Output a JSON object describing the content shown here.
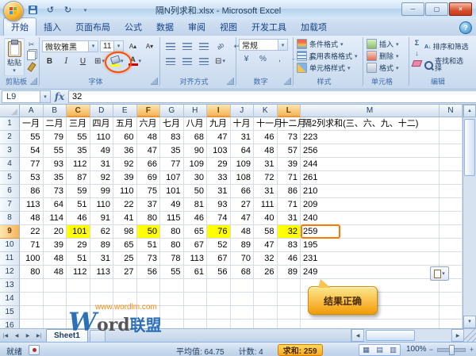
{
  "window": {
    "title": "隔N列求和.xlsx - Microsoft Excel"
  },
  "ribbon": {
    "tabs": [
      "开始",
      "插入",
      "页面布局",
      "公式",
      "数据",
      "审阅",
      "视图",
      "开发工具",
      "加载项"
    ],
    "active_tab": "开始",
    "clipboard": {
      "label": "剪贴板",
      "paste": "粘贴"
    },
    "font": {
      "label": "字体",
      "name": "微软雅黑",
      "size": "11",
      "bold": "B",
      "italic": "I",
      "underline": "U"
    },
    "alignment": {
      "label": "对齐方式"
    },
    "number": {
      "label": "数字",
      "format": "常规"
    },
    "styles": {
      "label": "样式",
      "conditional": "条件格式",
      "format_as_table": "套用表格格式",
      "cell_styles": "单元格样式"
    },
    "cells": {
      "label": "单元格",
      "insert": "插入",
      "delete": "删除",
      "format": "格式"
    },
    "editing": {
      "label": "编辑",
      "sort_filter": "排序和筛选",
      "find_select": "查找和选择"
    }
  },
  "formula_bar": {
    "name_box": "L9",
    "fx": "fx",
    "value": "32"
  },
  "sheet": {
    "columns": [
      "A",
      "B",
      "C",
      "D",
      "E",
      "F",
      "G",
      "H",
      "I",
      "J",
      "K",
      "L",
      "M",
      "N"
    ],
    "selected_columns": [
      "C",
      "F",
      "I",
      "L"
    ],
    "selected_row": 9,
    "month_headers": [
      "一月",
      "二月",
      "三月",
      "四月",
      "五月",
      "六月",
      "七月",
      "八月",
      "九月",
      "十月",
      "十一月",
      "十二月"
    ],
    "sum_header": "隔2列求和(三、六、九、十二)",
    "rows": [
      [
        55,
        79,
        55,
        110,
        60,
        48,
        83,
        68,
        47,
        31,
        46,
        73,
        223
      ],
      [
        54,
        55,
        35,
        49,
        36,
        47,
        35,
        90,
        103,
        64,
        48,
        57,
        256
      ],
      [
        77,
        93,
        112,
        31,
        92,
        66,
        77,
        109,
        29,
        109,
        31,
        39,
        244
      ],
      [
        53,
        35,
        87,
        92,
        39,
        69,
        107,
        30,
        33,
        108,
        72,
        71,
        261
      ],
      [
        86,
        73,
        59,
        99,
        110,
        75,
        101,
        50,
        31,
        66,
        31,
        86,
        210
      ],
      [
        113,
        64,
        51,
        110,
        22,
        37,
        49,
        81,
        93,
        27,
        111,
        71,
        209
      ],
      [
        48,
        114,
        46,
        91,
        41,
        80,
        115,
        46,
        74,
        47,
        40,
        31,
        240
      ],
      [
        22,
        20,
        101,
        62,
        98,
        50,
        80,
        65,
        76,
        48,
        58,
        32,
        259
      ],
      [
        71,
        39,
        29,
        89,
        65,
        51,
        80,
        67,
        52,
        89,
        47,
        83,
        195
      ],
      [
        100,
        48,
        51,
        31,
        25,
        73,
        78,
        113,
        67,
        70,
        32,
        46,
        231
      ],
      [
        80,
        48,
        112,
        113,
        27,
        56,
        55,
        61,
        56,
        68,
        26,
        89,
        249
      ]
    ],
    "highlighted_cells": [
      {
        "col": "C",
        "row": 9
      },
      {
        "col": "F",
        "row": 9
      },
      {
        "col": "I",
        "row": 9
      },
      {
        "col": "L",
        "row": 9
      }
    ],
    "result_cell": {
      "col": "M",
      "row": 9
    },
    "sheet_tab": "Sheet1"
  },
  "status_bar": {
    "ready": "就绪",
    "average": "平均值: 64.75",
    "count": "计数: 4",
    "sum": "求和: 259",
    "zoom": "100%"
  },
  "callout": {
    "text": "结果正确"
  },
  "watermark": {
    "url": "www.wordlm.com",
    "brand_w": "W",
    "brand_ord": "ord",
    "brand_cn": "联盟"
  },
  "colors": {
    "selection_fill": "#ffff00",
    "result_ring": "#ff7800",
    "header_selected": "#f5b45a",
    "callout_top": "#fce98e",
    "callout_bottom": "#f09c05"
  },
  "icons": {
    "dropdown": "▾",
    "scissors": "✂",
    "grow_font": "A▴",
    "shrink_font": "A▾",
    "borders": "⊞",
    "merge_center": "⊟",
    "currency": "¥",
    "percent": "%",
    "comma": ",",
    "inc_decimal": "←.0",
    "dec_decimal": ".0→",
    "sigma": "Σ",
    "fill_down": "↓",
    "sort": "A↓",
    "help": "?",
    "undo": "↺",
    "redo": "↻",
    "win_min": "─",
    "win_max": "▢",
    "win_close": "×",
    "nav_first": "|◀",
    "nav_prev": "◀",
    "nav_next": "▶",
    "nav_last": "▶|",
    "up": "▲",
    "down": "▼",
    "left": "◀",
    "right": "▶",
    "view_normal": "▦",
    "view_layout": "▤",
    "view_break": "▥",
    "minus": "−",
    "plus": "+",
    "rotate_text": "ab",
    "wrap": "↩"
  }
}
